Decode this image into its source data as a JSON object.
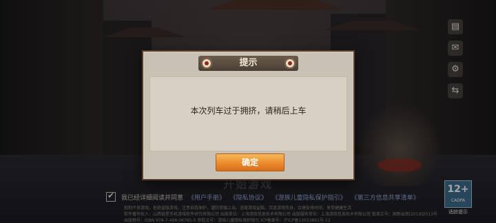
{
  "dialog": {
    "title": "提示",
    "message": "本次列车过于拥挤，请稍后上车",
    "confirm_label": "确定"
  },
  "background": {
    "start_game": "开始游戏",
    "agreement": {
      "prefix": "我已经详细阅读并同意",
      "links": [
        "《用户手册》",
        "《隐私协议》",
        "《游族儿童隐私保护指引》",
        "《第三方信息共享清单》"
      ]
    },
    "footer_lines": [
      "抵制不良游戏，拒绝盗版游戏，注意自我保护，谨防受骗上当。适度游戏益脑，沉迷游戏伤身，合理安排时间，享受健康生活",
      "软件著作权人：山西链星手机游戏软件研究有限公司 出版单位：上海游族信息技术有限公司 出版服务单位：上海游族信息技术有限公司 批准文号：国新出审[2019]2513号",
      "出版物号：ISBN 978-7-498-06785-5 审批文号：游族儿童隐私保护指引 ICP备案号：沪ICP备13033861号-12"
    ],
    "age_rating": {
      "number": "12+",
      "org": "CADPA",
      "label": "适龄提示"
    }
  },
  "side_icons": [
    "notice-icon",
    "mail-icon",
    "settings-icon",
    "switch-account-icon"
  ]
}
